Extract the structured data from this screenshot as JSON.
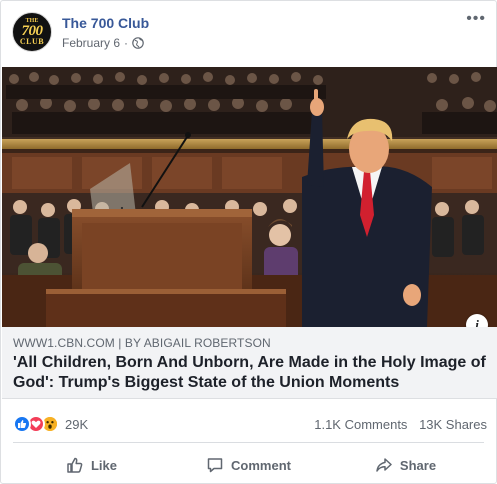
{
  "post": {
    "page_name": "The 700 Club",
    "date": "February 6",
    "separator": "·",
    "privacy_icon": "globe-icon",
    "more_icon": "more-icon",
    "logo": {
      "top": "THE",
      "middle": "700",
      "bottom": "CLUB"
    }
  },
  "link": {
    "source": "WWW1.CBN.COM | BY ABIGAIL ROBERTSON",
    "title": "'All Children, Born And Unborn, Are Made in the Holy Image of God': Trump's Biggest State of the Union Moments",
    "info_label": "i"
  },
  "stats": {
    "reaction_icons": [
      "like-icon",
      "love-icon",
      "wow-icon"
    ],
    "reaction_count": "29K",
    "comments": "1.1K Comments",
    "shares": "13K Shares"
  },
  "actions": {
    "like": "Like",
    "comment": "Comment",
    "share": "Share"
  },
  "colors": {
    "page_name": "#385898",
    "like_blue": "#1877f2",
    "love_red": "#f33e58",
    "wow_yellow": "#f7b125",
    "tie_red": "#d1202f"
  }
}
